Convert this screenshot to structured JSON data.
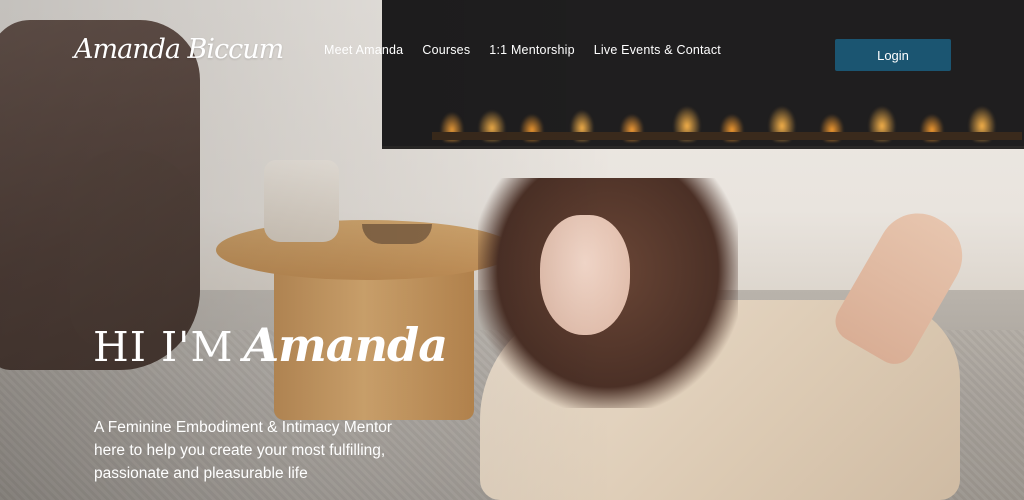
{
  "brand": {
    "logo_text": "Amanda Biccum"
  },
  "nav": {
    "items": [
      {
        "label": "Meet Amanda"
      },
      {
        "label": "Courses"
      },
      {
        "label": "1:1 Mentorship"
      },
      {
        "label": "Live Events & Contact"
      }
    ],
    "login_label": "Login"
  },
  "hero": {
    "greeting": "HI I'M",
    "name": "Amanda",
    "subtitle_lines": [
      "A Feminine Embodiment & Intimacy Mentor",
      "here to help you create your most fulfilling,",
      "passionate and pleasurable life"
    ]
  },
  "colors": {
    "login_bg": "#1b5571",
    "text": "#ffffff"
  }
}
